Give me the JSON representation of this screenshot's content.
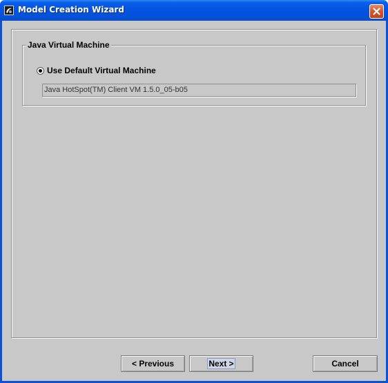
{
  "window": {
    "title": "Model Creation Wizard",
    "app_icon": "java-app-icon",
    "close_icon": "close-icon"
  },
  "jvm_group": {
    "title": "Java Virtual Machine",
    "option": {
      "label": "Use Default Virtual Machine",
      "selected": true
    },
    "vm_value": "Java HotSpot(TM) Client VM  1.5.0_05-b05"
  },
  "buttons": {
    "previous": "< Previous",
    "next": "Next >",
    "cancel": "Cancel"
  },
  "colors": {
    "titlebar": "#0554e0",
    "window_bg": "#c8c8c8",
    "close_button": "#d6532c"
  }
}
